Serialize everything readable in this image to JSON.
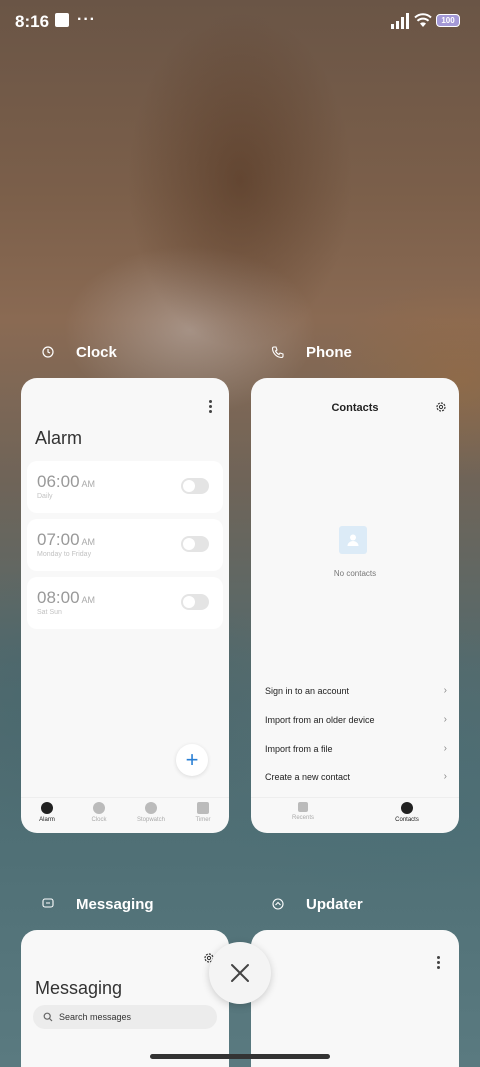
{
  "status_bar": {
    "time": "8:16",
    "more": "···",
    "battery": "100"
  },
  "recents": [
    {
      "app_name": "Clock",
      "alarm_title": "Alarm",
      "alarms": [
        {
          "time": "06:00",
          "ampm": "AM",
          "repeat": "Daily"
        },
        {
          "time": "07:00",
          "ampm": "AM",
          "repeat": "Monday to Friday"
        },
        {
          "time": "08:00",
          "ampm": "AM",
          "repeat": "Sat Sun"
        }
      ],
      "fab": "+",
      "nav": [
        "Alarm",
        "Clock",
        "Stopwatch",
        "Timer"
      ]
    },
    {
      "app_name": "Phone",
      "title": "Contacts",
      "empty_text": "No contacts",
      "actions": [
        "Sign in to an account",
        "Import from an older device",
        "Import from a file",
        "Create a new contact"
      ],
      "nav": [
        "Recents",
        "Contacts"
      ]
    },
    {
      "app_name": "Messaging",
      "title": "Messaging",
      "search_placeholder": "Search messages"
    },
    {
      "app_name": "Updater"
    }
  ],
  "colors": {
    "accent": "#2a7fd4",
    "card_bg": "#f8f8f8"
  }
}
